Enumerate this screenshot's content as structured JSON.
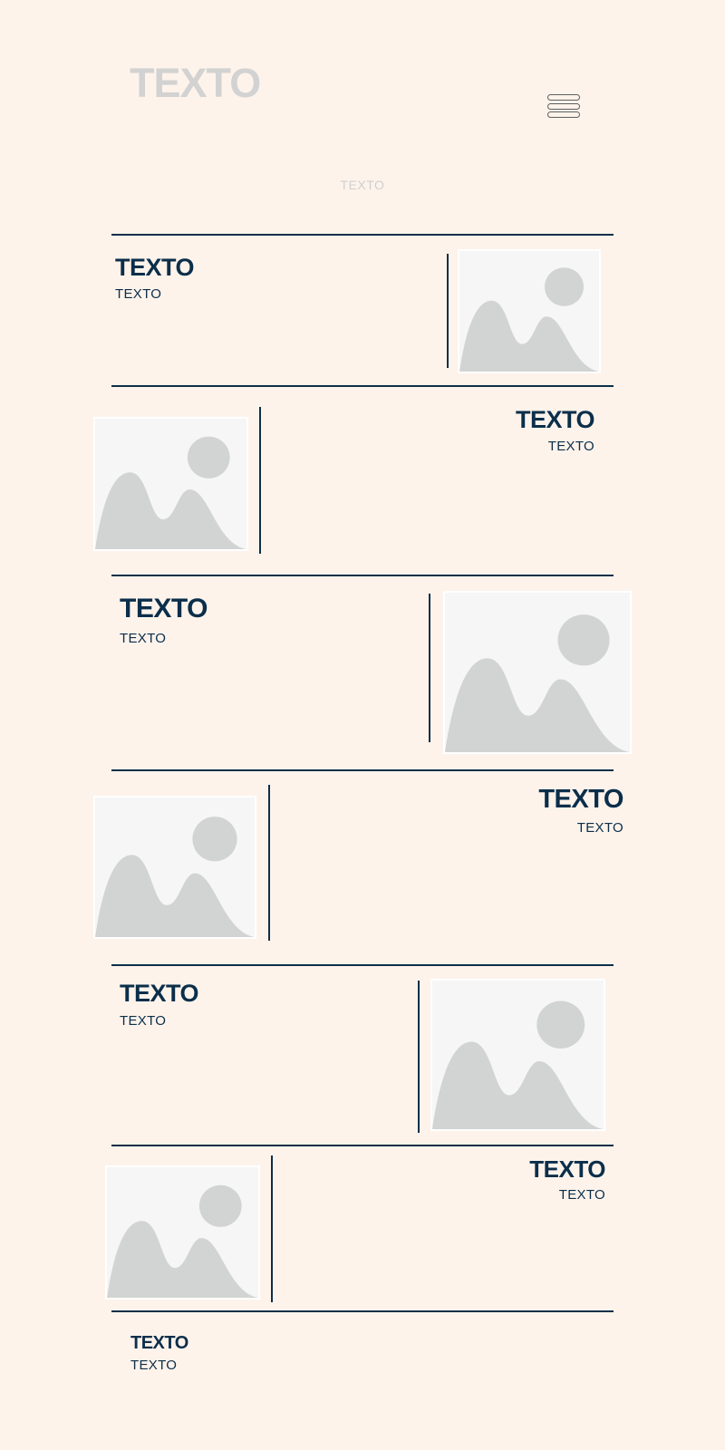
{
  "header": {
    "logo": "TEXTO",
    "subtitle": "TEXTO"
  },
  "menu": {
    "icon": "hamburger-icon"
  },
  "items": [
    {
      "title": "TEXTO",
      "text": "TEXTO"
    },
    {
      "title": "TEXTO",
      "text": "TEXTO"
    },
    {
      "title": "TEXTO",
      "text": "TEXTO"
    },
    {
      "title": "TEXTO",
      "text": "TEXTO"
    },
    {
      "title": "TEXTO",
      "text": "TEXTO"
    },
    {
      "title": "TEXTO",
      "text": "TEXTO"
    },
    {
      "title": "TEXTO",
      "text": "TEXTO"
    }
  ],
  "image_icon": "image-placeholder-icon",
  "colors": {
    "background": "#fdf3eb",
    "accent": "#0b2e4a",
    "muted": "#d2d2d2"
  }
}
